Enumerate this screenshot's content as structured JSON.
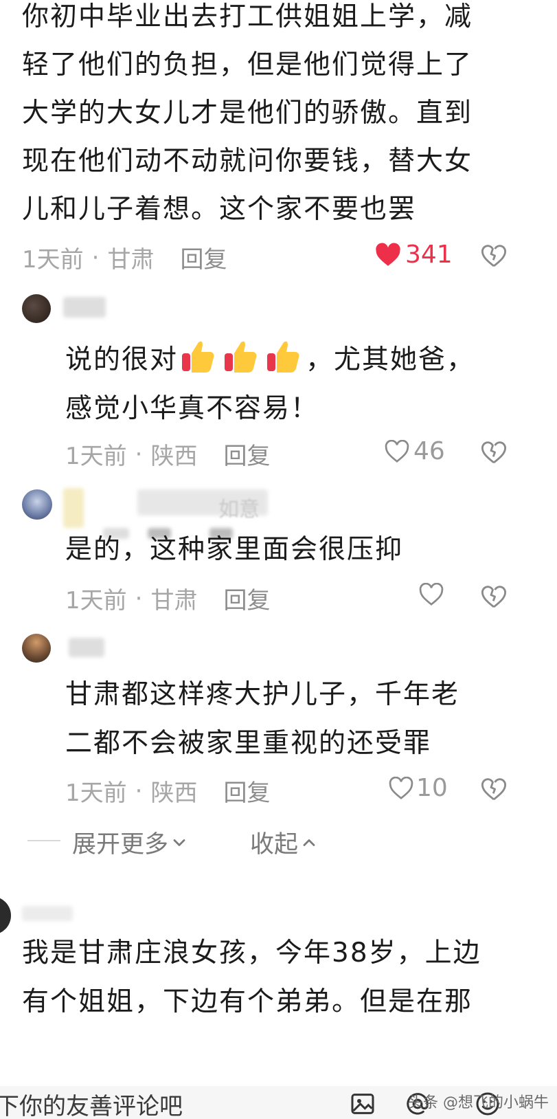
{
  "comments": [
    {
      "lines": [
        "你初中毕业出去打工供姐姐上学，减",
        "轻了他们的负担，但是他们觉得上了",
        "大学的大女儿才是他们的骄傲。直到",
        "现在他们动不动就问你要钱，替大女",
        "儿和儿子着想。这个家不要也罢"
      ],
      "time": "1天前",
      "location": "甘肃",
      "reply": "回复",
      "likes": "341",
      "liked": true
    },
    {
      "line1_prefix": "说的很对",
      "line1_suffix": "，尤其她爸，",
      "line2": "感觉小华真不容易！",
      "time": "1天前",
      "location": "陕西",
      "reply": "回复",
      "likes": "46"
    },
    {
      "username_fragment": "如意",
      "line1": "是的，这种家里面会很压抑",
      "time": "1天前",
      "location": "甘肃",
      "reply": "回复",
      "likes": ""
    },
    {
      "lines": [
        "甘肃都这样疼大护儿子，千年老",
        "二都不会被家里重视的还受罪"
      ],
      "time": "1天前",
      "location": "陕西",
      "reply": "回复",
      "likes": "10"
    }
  ],
  "expand": {
    "more": "展开更多",
    "collapse": "收起"
  },
  "comment5": {
    "lines": [
      "我是甘肃庄浪女孩，今年38岁，上边",
      "有个姐姐，下边有个弟弟。但是在那"
    ]
  },
  "input": {
    "placeholder": "下你的友善评论吧"
  },
  "watermark": "头条 @想飞的小蜗牛",
  "colors": {
    "liked": "#ee2f4a",
    "meta": "#a6a6a6",
    "text": "#1b1b1b"
  },
  "icons": [
    "heart-icon",
    "dislike-heart-icon",
    "thumbs-up-emoji",
    "image-icon",
    "at-icon",
    "chevron-down-icon",
    "chevron-up-icon"
  ]
}
